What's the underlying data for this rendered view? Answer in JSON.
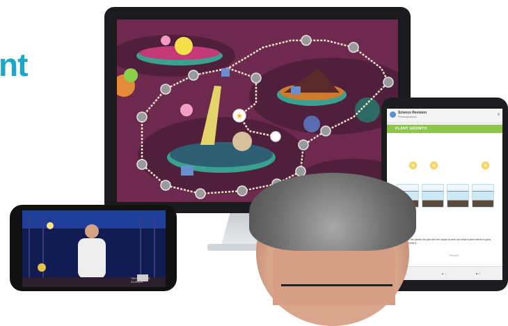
{
  "headline": {
    "text": "nt",
    "color": "#1aa7c9"
  },
  "monitor": {
    "screen_description_color": "#6e2a4e",
    "map": {
      "path_color": "#f2e5c8",
      "node_color": "#9a9a9a",
      "star_node_color": "#ffffff",
      "star_color": "#f3b81b"
    }
  },
  "tablet": {
    "app_name": "Science Revision",
    "app_subtitle": "Photosynthesis",
    "section_title": "PLANT GROWTH",
    "body_text": "Compare the plants, the jars and the lamps to work out what a plant needs to grow. Drag it, move it.",
    "small_label": "Results",
    "bottom_nav": [
      "◦",
      "▲ 1",
      "■ 0"
    ],
    "accent": "#8cc64a"
  },
  "phone": {
    "caption": "TIM ELECTRIC\nSCIENCE",
    "screen_color": "#0d1a4a"
  },
  "person": {
    "hair_color": "#7a7a7a",
    "skin_color": "#d59e85"
  }
}
